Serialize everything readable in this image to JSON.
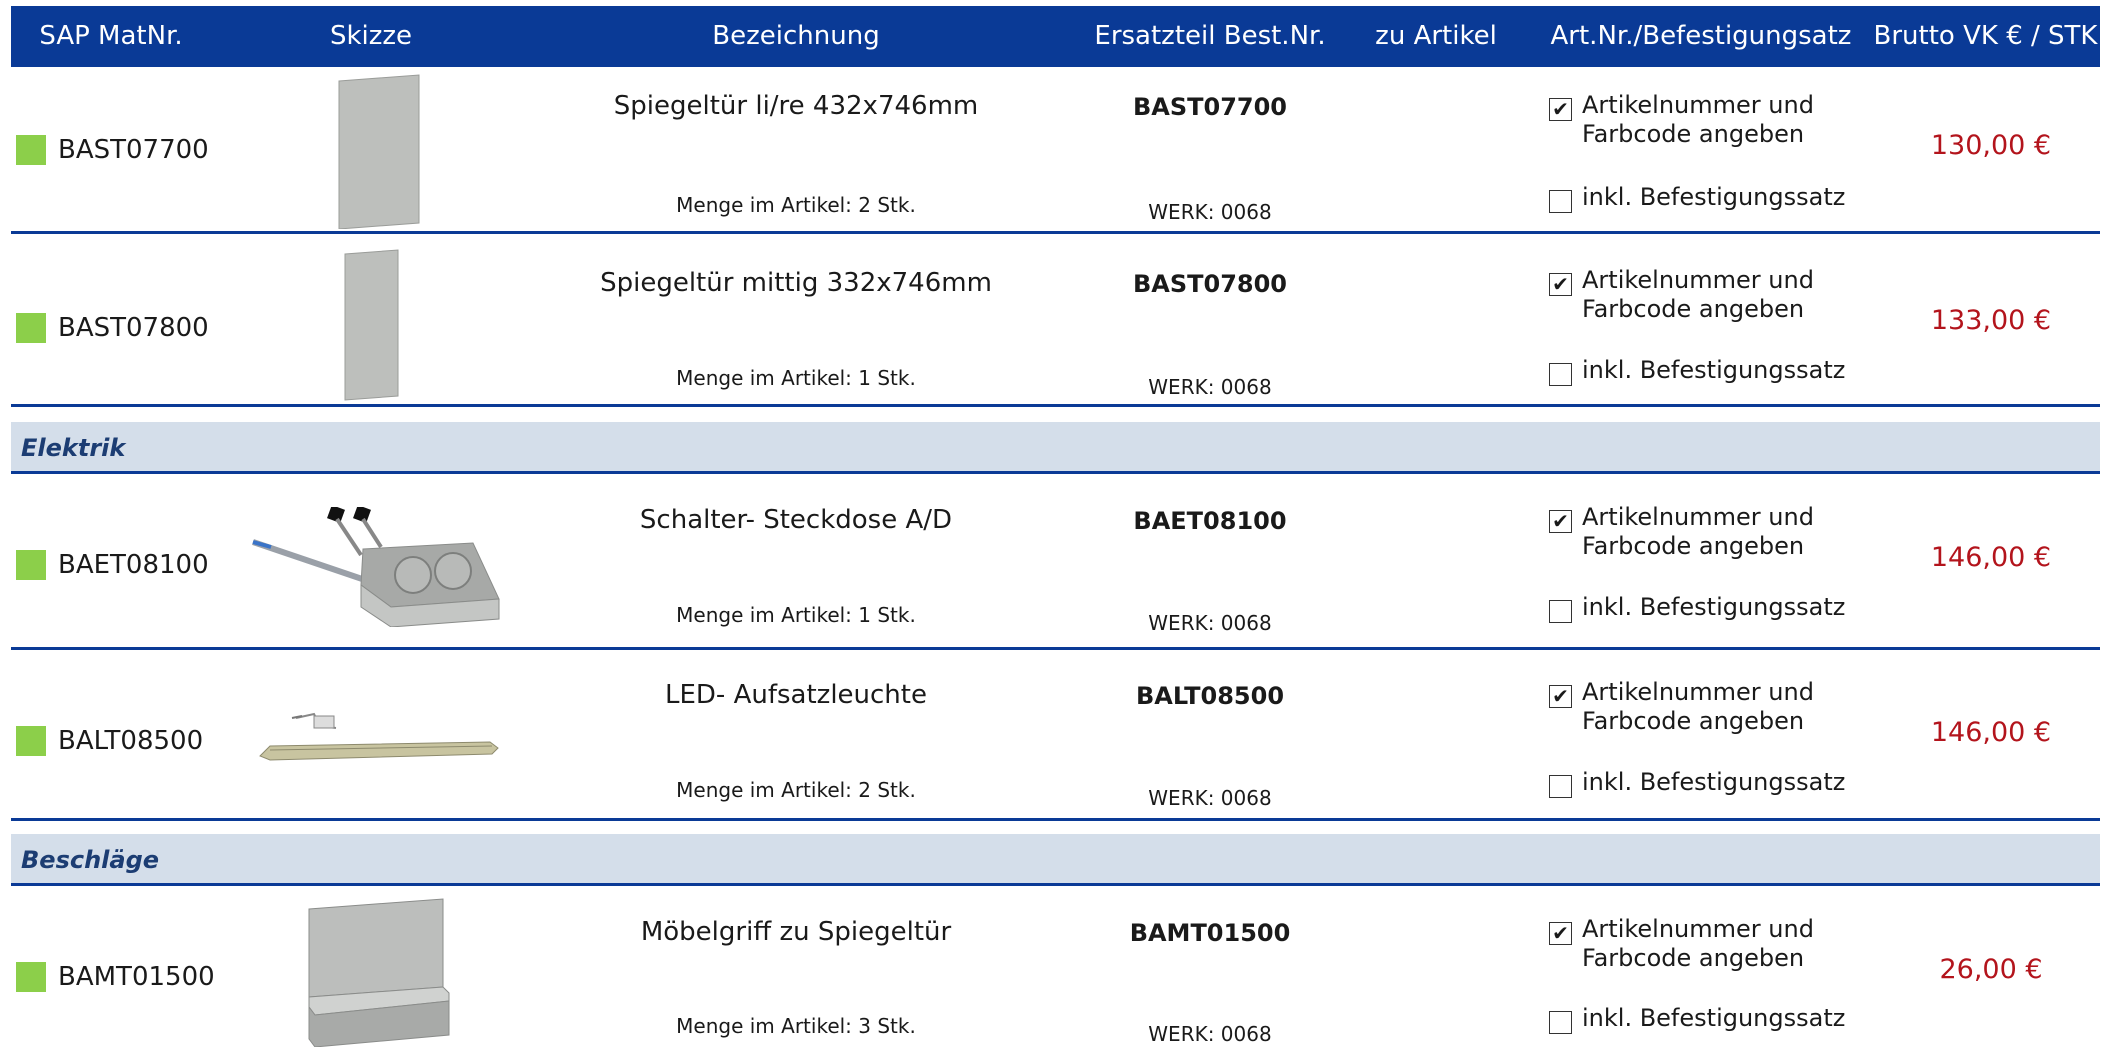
{
  "header": {
    "sap": "SAP MatNr.",
    "sketch": "Skizze",
    "name": "Bezeichnung",
    "part": "Ersatzteil Best.Nr.",
    "article": "zu Artikel",
    "kit": "Art.Nr./Befestigungsatz",
    "price": "Brutto VK € / STK"
  },
  "option_labels": {
    "artnr": "Artikelnummer und\nFarbcode angeben",
    "kit": "inkl. Befestigungssatz"
  },
  "sections": [
    {
      "title": "Elektrik"
    },
    {
      "title": "Beschläge"
    }
  ],
  "rows": [
    {
      "sap": "BAST07700",
      "name": "Spiegeltür li/re 432x746mm",
      "qty": "Menge im Artikel: 2 Stk.",
      "part": "BAST07700",
      "werk": "WERK: 0068",
      "artnr_checked": "✔",
      "price": "130,00 €",
      "sketch_icon": "mirror-door-icon"
    },
    {
      "sap": "BAST07800",
      "name": "Spiegeltür mittig 332x746mm",
      "qty": "Menge im Artikel: 1 Stk.",
      "part": "BAST07800",
      "werk": "WERK: 0068",
      "artnr_checked": "✔",
      "price": "133,00 €",
      "sketch_icon": "mirror-door-icon"
    },
    {
      "sap": "BAET08100",
      "name": "Schalter- Steckdose A/D",
      "qty": "Menge im Artikel: 1 Stk.",
      "part": "BAET08100",
      "werk": "WERK: 0068",
      "artnr_checked": "✔",
      "price": "146,00 €",
      "sketch_icon": "switch-socket-icon"
    },
    {
      "sap": "BALT08500",
      "name": "LED- Aufsatzleuchte",
      "qty": "Menge im Artikel: 2 Stk.",
      "part": "BALT08500",
      "werk": "WERK: 0068",
      "artnr_checked": "✔",
      "price": "146,00 €",
      "sketch_icon": "led-light-icon"
    },
    {
      "sap": "BAMT01500",
      "name": "Möbelgriff zu Spiegeltür",
      "qty": "Menge im Artikel: 3 Stk.",
      "part": "BAMT01500",
      "werk": "WERK: 0068",
      "artnr_checked": "✔",
      "price": "26,00 €",
      "sketch_icon": "furniture-handle-icon"
    }
  ],
  "colors": {
    "header_bg": "#0a3a96",
    "section_bg": "#d4deea",
    "status_square": "#8ccf4a",
    "price": "#b3141c"
  }
}
